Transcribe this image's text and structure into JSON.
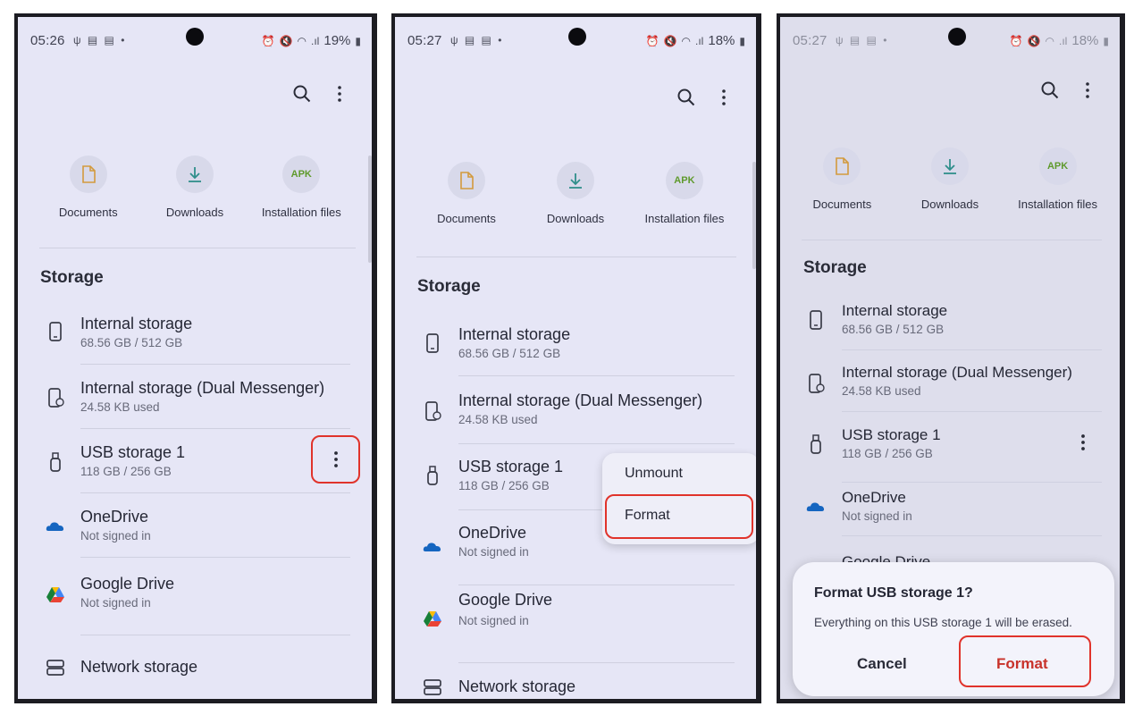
{
  "panels": [
    {
      "status": {
        "time": "05:26",
        "battery": "19%"
      },
      "categories": [
        {
          "label": "Documents",
          "icon": "document-icon"
        },
        {
          "label": "Downloads",
          "icon": "download-icon"
        },
        {
          "label": "Installation files",
          "icon": "apk-icon",
          "badge": "APK"
        }
      ],
      "storage_heading": "Storage",
      "items": [
        {
          "title": "Internal storage",
          "subtitle": "68.56 GB / 512 GB"
        },
        {
          "title": "Internal storage (Dual Messenger)",
          "subtitle": "24.58 KB used"
        },
        {
          "title": "USB storage 1",
          "subtitle": "118 GB / 256 GB"
        },
        {
          "title": "OneDrive",
          "subtitle": "Not signed in"
        },
        {
          "title": "Google Drive",
          "subtitle": "Not signed in"
        },
        {
          "title": "Network storage"
        }
      ]
    },
    {
      "status": {
        "time": "05:27",
        "battery": "18%"
      },
      "categories": [
        {
          "label": "Documents"
        },
        {
          "label": "Downloads"
        },
        {
          "label": "Installation files",
          "badge": "APK"
        }
      ],
      "storage_heading": "Storage",
      "items": [
        {
          "title": "Internal storage",
          "subtitle": "68.56 GB / 512 GB"
        },
        {
          "title": "Internal storage (Dual Messenger)",
          "subtitle": "24.58 KB used"
        },
        {
          "title": "USB storage 1",
          "subtitle": "118 GB / 256 GB"
        },
        {
          "title": "OneDrive",
          "subtitle": "Not signed in"
        },
        {
          "title": "Google Drive",
          "subtitle": "Not signed in"
        },
        {
          "title": "Network storage"
        }
      ],
      "menu": {
        "unmount": "Unmount",
        "format": "Format"
      }
    },
    {
      "status": {
        "time": "05:27",
        "battery": "18%"
      },
      "categories": [
        {
          "label": "Documents"
        },
        {
          "label": "Downloads"
        },
        {
          "label": "Installation files",
          "badge": "APK"
        }
      ],
      "storage_heading": "Storage",
      "items": [
        {
          "title": "Internal storage",
          "subtitle": "68.56 GB / 512 GB"
        },
        {
          "title": "Internal storage (Dual Messenger)",
          "subtitle": "24.58 KB used"
        },
        {
          "title": "USB storage 1",
          "subtitle": "118 GB / 256 GB"
        },
        {
          "title": "OneDrive",
          "subtitle": "Not signed in"
        },
        {
          "title": "Google Drive"
        }
      ],
      "dialog": {
        "title": "Format USB storage 1?",
        "message": "Everything on this USB storage 1 will be erased.",
        "cancel": "Cancel",
        "confirm": "Format"
      }
    }
  ],
  "colors": {
    "background": "#e6e6f6",
    "highlight": "#e0332b",
    "onedrive": "#1565c0",
    "apk": "#5f9a2c"
  }
}
